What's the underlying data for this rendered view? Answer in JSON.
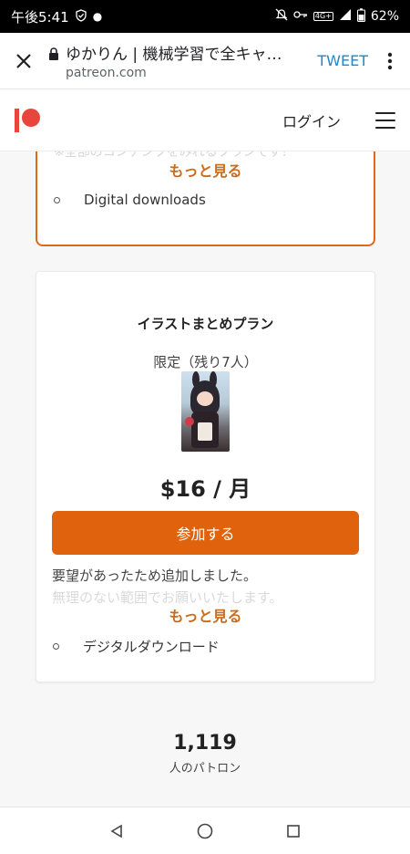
{
  "status_bar": {
    "time": "午後5:41",
    "network": "4G+",
    "battery": "62%"
  },
  "browser": {
    "title": "ゆかりん | 機械学習で全キャ…",
    "url": "patreon.com",
    "tweet_label": "TWEET"
  },
  "header": {
    "login_label": "ログイン",
    "brand_color": "#e8453c"
  },
  "previous_tier": {
    "faded_text": "※全部のコンテンツをみれるプランです！",
    "more_label": "もっと見る",
    "benefits": [
      "Digital downloads"
    ]
  },
  "tier": {
    "title": "イラストまとめプラン",
    "limited_text": "限定（残り7人）",
    "price": "$16 / 月",
    "join_label": "参加する",
    "description": "要望があったため追加しました。",
    "description_faded": "無理のない範囲でお願いいたします。",
    "more_label": "もっと見る",
    "benefits": [
      "デジタルダウンロード"
    ],
    "accent_color": "#e0620c"
  },
  "stats": {
    "patron_count": "1,119",
    "patron_label": "人のパトロン"
  }
}
